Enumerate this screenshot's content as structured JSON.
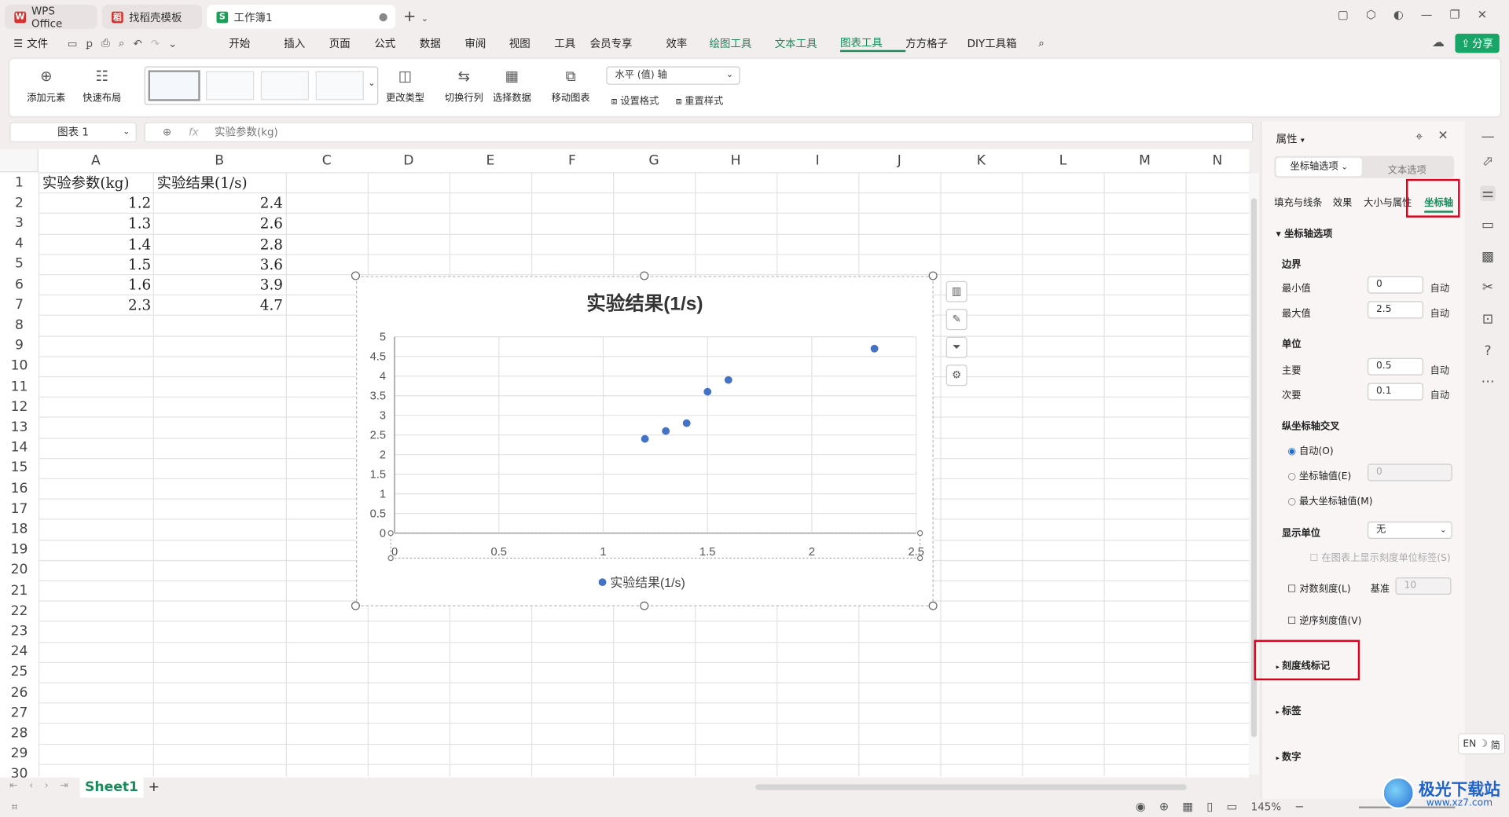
{
  "tabs": [
    {
      "label": "WPS Office",
      "icon": "W"
    },
    {
      "label": "找稻壳模板",
      "icon": "稻"
    },
    {
      "label": "工作簿1",
      "icon": "S"
    }
  ],
  "menu": {
    "file": "文件",
    "items": [
      "开始",
      "插入",
      "页面",
      "公式",
      "数据",
      "审阅",
      "视图",
      "工具",
      "会员专享",
      "效率",
      "绘图工具",
      "文本工具",
      "图表工具",
      "方方格子",
      "DIY工具箱"
    ],
    "share": "分享"
  },
  "ribbon": {
    "add_element": "添加元素",
    "quick_layout": "快速布局",
    "change_type": "更改类型",
    "switch_rowcol": "切换行列",
    "select_data": "选择数据",
    "move_chart": "移动图表",
    "axis_select": "水平 (值) 轴",
    "set_format": "设置格式",
    "reset_style": "重置样式"
  },
  "formula": {
    "name_box": "图表 1",
    "fx": "fx",
    "content": "实验参数(kg)"
  },
  "columns": [
    "A",
    "B",
    "C",
    "D",
    "E",
    "F",
    "G",
    "H",
    "I",
    "J",
    "K",
    "L",
    "M",
    "N"
  ],
  "rows": [
    "1",
    "2",
    "3",
    "4",
    "5",
    "6",
    "7",
    "8",
    "9",
    "10",
    "11",
    "12",
    "13",
    "14",
    "15",
    "16",
    "17",
    "18",
    "19",
    "20",
    "21",
    "22",
    "23",
    "24",
    "25",
    "26",
    "27",
    "28",
    "29",
    "30"
  ],
  "sheet": {
    "a1": "实验参数(kg)",
    "b1": "实验结果(1/s)",
    "a": [
      "1.2",
      "1.3",
      "1.4",
      "1.5",
      "1.6",
      "2.3"
    ],
    "b": [
      "2.4",
      "2.6",
      "2.8",
      "3.6",
      "3.9",
      "4.7"
    ]
  },
  "chart_data": {
    "type": "scatter",
    "title": "实验结果(1/s)",
    "series": [
      {
        "name": "实验结果(1/s)",
        "x": [
          1.2,
          1.3,
          1.4,
          1.5,
          1.6,
          2.3
        ],
        "y": [
          2.4,
          2.6,
          2.8,
          3.6,
          3.9,
          4.7
        ],
        "color": "#4472c4"
      }
    ],
    "xlim": [
      0,
      2.5
    ],
    "ylim": [
      0,
      5
    ],
    "xticks": [
      "0",
      "0.5",
      "1",
      "1.5",
      "2",
      "2.5"
    ],
    "yticks": [
      "0",
      "0.5",
      "1",
      "1.5",
      "2",
      "2.5",
      "3",
      "3.5",
      "4",
      "4.5",
      "5"
    ],
    "grid": true,
    "legend": "bottom"
  },
  "panel": {
    "title": "属性",
    "tab1": "坐标轴选项",
    "tab2": "文本选项",
    "sub": [
      "填充与线条",
      "效果",
      "大小与属性",
      "坐标轴"
    ],
    "section": "坐标轴选项",
    "bounds": "边界",
    "min_label": "最小值",
    "min_val": "0",
    "max_label": "最大值",
    "max_val": "2.5",
    "auto": "自动",
    "unit": "单位",
    "major_label": "主要",
    "major_val": "0.5",
    "minor_label": "次要",
    "minor_val": "0.1",
    "cross": "纵坐标轴交叉",
    "opt_auto": "自动(O)",
    "opt_val": "坐标轴值(E)",
    "opt_val_v": "0",
    "opt_max": "最大坐标轴值(M)",
    "display_unit": "显示单位",
    "display_unit_val": "无",
    "show_unit_label": "在图表上显示刻度单位标签(S)",
    "log": "对数刻度(L)",
    "base": "基准",
    "base_val": "10",
    "reverse": "逆序刻度值(V)",
    "tick_marks": "刻度线标记",
    "labels": "标签",
    "number": "数字"
  },
  "status": {
    "sheet_tab": "Sheet1",
    "zoom": "145%",
    "ime": "EN",
    "ime2": "简"
  },
  "watermark": {
    "text": "极光下载站",
    "url": "www.xz7.com"
  }
}
